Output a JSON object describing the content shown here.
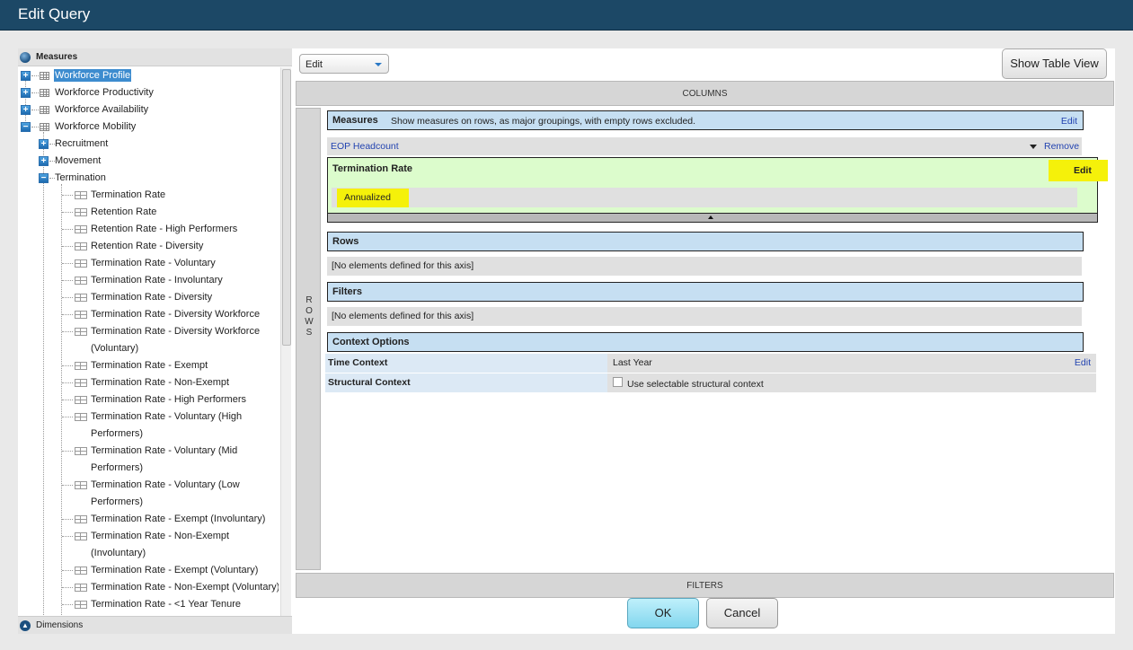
{
  "window": {
    "title": "Edit Query"
  },
  "tree": {
    "measures_label": "Measures",
    "dimensions_label": "Dimensions",
    "top_items": [
      "Workforce Profile",
      "Workforce Productivity",
      "Workforce Availability",
      "Workforce Mobility"
    ],
    "mobility_children": [
      "Recruitment",
      "Movement",
      "Termination"
    ],
    "termination_items": [
      "Termination Rate",
      "Retention Rate",
      "Retention Rate - High Performers",
      "Retention Rate - Diversity",
      "Termination Rate - Voluntary",
      "Termination Rate - Involuntary",
      "Termination Rate - Diversity",
      "Termination Rate - Diversity Workforce",
      "Termination Rate - Diversity Workforce",
      "(Voluntary)",
      "Termination Rate - Exempt",
      "Termination Rate - Non-Exempt",
      "Termination Rate - High Performers",
      "Termination Rate - Voluntary (High",
      "Performers)",
      "Termination Rate - Voluntary (Mid",
      "Performers)",
      "Termination Rate - Voluntary (Low",
      "Performers)",
      "Termination Rate - Exempt (Involuntary)",
      "Termination Rate - Non-Exempt",
      "(Involuntary)",
      "Termination Rate - Exempt (Voluntary)",
      "Termination Rate - Non-Exempt (Voluntary)",
      "Termination Rate - <1 Year Tenure"
    ]
  },
  "toolbar": {
    "mode_value": "Edit",
    "show_table_view": "Show Table View"
  },
  "axes": {
    "columns": "COLUMNS",
    "filters": "FILTERS",
    "rows_letters": [
      "R",
      "O",
      "W",
      "S"
    ]
  },
  "measures_section": {
    "title": "Measures",
    "description": "Show measures on rows, as major groupings, with empty rows excluded.",
    "edit": "Edit",
    "eop_headcount": "EOP Headcount",
    "remove": "Remove",
    "termination_rate": "Termination Rate",
    "termination_edit": "Edit",
    "annualized": "Annualized"
  },
  "rows_section": {
    "title": "Rows",
    "empty": "[No elements defined for this axis]"
  },
  "filters_section": {
    "title": "Filters",
    "empty": "[No elements defined for this axis]"
  },
  "context_section": {
    "title": "Context Options",
    "time_label": "Time Context",
    "time_value": "Last Year",
    "time_edit": "Edit",
    "structural_label": "Structural Context",
    "structural_checkbox_label": "Use selectable structural context"
  },
  "buttons": {
    "ok": "OK",
    "cancel": "Cancel"
  },
  "colors": {
    "title_bar": "#1c4866",
    "section_header": "#c6dff2",
    "highlight": "#f5f10a",
    "selected_measure_bg": "#dcfccc",
    "link": "#2243b0",
    "ok_button": "#82d6ee"
  }
}
